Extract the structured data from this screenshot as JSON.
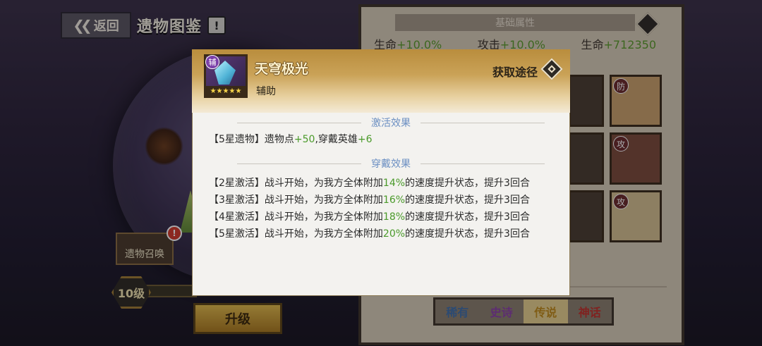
{
  "header": {
    "back_label": "返回",
    "title": "遗物图鉴",
    "warn": "!"
  },
  "scene": {
    "summon_label": "遗物召唤",
    "summon_badge": "!",
    "level": "10级",
    "upgrade_label": "升级"
  },
  "right_panel": {
    "header": "基础属性",
    "stats": [
      {
        "label": "生命",
        "value": "+10.0%"
      },
      {
        "label": "攻击",
        "value": "+10.0%"
      },
      {
        "label": "生命",
        "value": "+712350"
      }
    ],
    "card_tags": [
      "防",
      "攻",
      "攻"
    ],
    "rarity_tabs": [
      "稀有",
      "史诗",
      "传说",
      "神话"
    ]
  },
  "modal": {
    "relic_tag": "辅",
    "relic_stars": "★★★★★",
    "relic_name": "天穹极光",
    "relic_type": "辅助",
    "source_label": "获取途径",
    "activate_title": "激活效果",
    "activate_prefix": "【5星遗物】遗物点",
    "activate_points": "+50",
    "activate_mid": ",穿戴英雄",
    "activate_heroes": "+6",
    "wear_title": "穿戴效果",
    "wear_rows": [
      {
        "tag": "【2星激活】",
        "pre": "战斗开始，为我方全体附加",
        "pct": "14%",
        "post": "的速度提升状态，提升3回合"
      },
      {
        "tag": "【3星激活】",
        "pre": "战斗开始，为我方全体附加",
        "pct": "16%",
        "post": "的速度提升状态，提升3回合"
      },
      {
        "tag": "【4星激活】",
        "pre": "战斗开始，为我方全体附加",
        "pct": "18%",
        "post": "的速度提升状态，提升3回合"
      },
      {
        "tag": "【5星激活】",
        "pre": "战斗开始，为我方全体附加",
        "pct": "20%",
        "post": "的速度提升状态，提升3回合"
      }
    ]
  },
  "colors": {
    "accent_green": "#4a9a2a",
    "section_blue": "#6b8fc2",
    "gold": "#caa257"
  }
}
